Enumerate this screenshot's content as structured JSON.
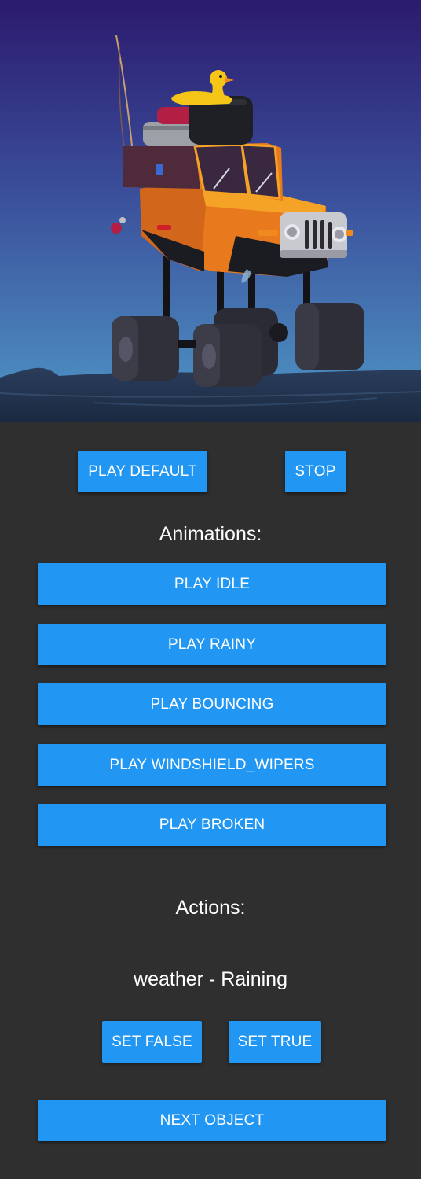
{
  "scene": {
    "description_icon": "monster-jeep-illustration",
    "colors": {
      "sky_top": "#2c1a6e",
      "sky_bottom": "#4a8fc0",
      "ground": "#1f2e47",
      "jeep_body": "#e8791c",
      "tires": "#2a2a33"
    }
  },
  "controls": {
    "play_default_label": "PLAY DEFAULT",
    "stop_label": "STOP"
  },
  "animations": {
    "heading": "Animations:",
    "buttons": [
      {
        "label": "PLAY IDLE"
      },
      {
        "label": "PLAY RAINY"
      },
      {
        "label": "PLAY BOUNCING"
      },
      {
        "label": "PLAY WINDSHIELD_WIPERS"
      },
      {
        "label": "PLAY BROKEN"
      }
    ]
  },
  "actions": {
    "heading": "Actions:",
    "input_label": "weather - Raining",
    "set_false_label": "SET FALSE",
    "set_true_label": "SET TRUE"
  },
  "next_object_label": "NEXT OBJECT",
  "theme": {
    "accent": "#2196f3",
    "background": "#2f2f2f",
    "text": "#ffffff"
  }
}
